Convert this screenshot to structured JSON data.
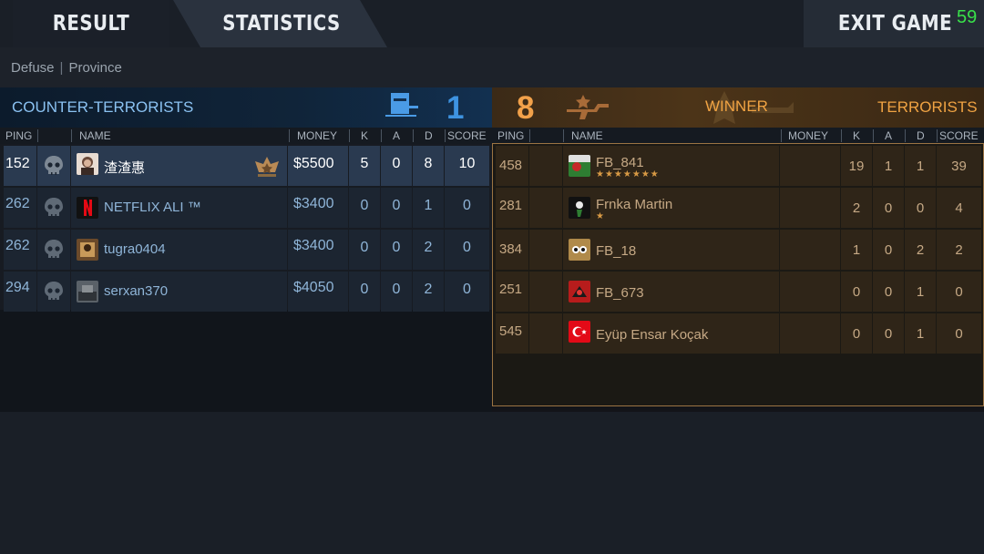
{
  "tabs": {
    "result": "RESULT",
    "statistics": "STATISTICS",
    "exit": "EXIT GAME"
  },
  "fps": "59",
  "map": {
    "mode": "Defuse",
    "separator": "|",
    "name": "Province"
  },
  "teams": {
    "ct": {
      "name": "COUNTER-TERRORISTS",
      "score": "1",
      "color": "#3e93e0"
    },
    "t": {
      "name": "TERRORISTS",
      "score": "8",
      "result": "WINNER",
      "color": "#f0a343"
    }
  },
  "ct_columns": {
    "ping": "PING",
    "name": "NAME",
    "money": "MONEY",
    "k": "K",
    "a": "A",
    "d": "D",
    "score": "SCORE"
  },
  "t_columns": {
    "ping": "PING",
    "name": "NAME",
    "money": "MONEY",
    "k": "K",
    "a": "A",
    "d": "D",
    "score": "SCORE"
  },
  "ct_players": [
    {
      "ping": "152",
      "name": "渣渣惠",
      "money": "$5500",
      "k": "5",
      "a": "0",
      "d": "8",
      "score": "10",
      "avatar": "portrait-avatar",
      "rank": "rank-badge-icon"
    },
    {
      "ping": "262",
      "name": "NETFLIX ALI ™",
      "money": "$3400",
      "k": "0",
      "a": "0",
      "d": "1",
      "score": "0",
      "avatar": "netflix-avatar"
    },
    {
      "ping": "262",
      "name": "tugra0404",
      "money": "$3400",
      "k": "0",
      "a": "0",
      "d": "2",
      "score": "0",
      "avatar": "photo-avatar"
    },
    {
      "ping": "294",
      "name": "serxan370",
      "money": "$4050",
      "k": "0",
      "a": "0",
      "d": "2",
      "score": "0",
      "avatar": "photo-avatar"
    }
  ],
  "t_players": [
    {
      "ping": "458",
      "name": "FB_841",
      "stars": "★★★★★★★",
      "k": "19",
      "a": "1",
      "d": "1",
      "score": "39",
      "avatar": "flag-avatar"
    },
    {
      "ping": "281",
      "name": "Frnka Martin",
      "stars": "★",
      "k": "2",
      "a": "0",
      "d": "0",
      "score": "4",
      "avatar": "dark-avatar"
    },
    {
      "ping": "384",
      "name": "FB_18",
      "stars": "",
      "k": "1",
      "a": "0",
      "d": "2",
      "score": "2",
      "avatar": "cartoon-avatar"
    },
    {
      "ping": "251",
      "name": "FB_673",
      "stars": "",
      "k": "0",
      "a": "0",
      "d": "1",
      "score": "0",
      "avatar": "red-avatar"
    },
    {
      "ping": "545",
      "name": "Eyüp Ensar Koçak",
      "stars": "",
      "k": "0",
      "a": "0",
      "d": "1",
      "score": "0",
      "avatar": "turkey-flag-avatar"
    }
  ]
}
